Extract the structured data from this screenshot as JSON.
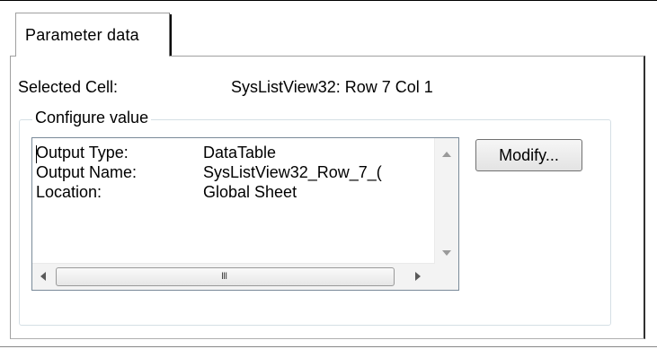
{
  "tab": {
    "label": "Parameter data"
  },
  "selected_cell": {
    "label": "Selected Cell:",
    "value": "SysListView32: Row 7 Col 1"
  },
  "configure_group": {
    "title": "Configure value",
    "rows": [
      {
        "key": "Output Type:",
        "value": "DataTable"
      },
      {
        "key": "Output Name:",
        "value": "SysListView32_Row_7_("
      },
      {
        "key": "Location:",
        "value": "Global Sheet"
      }
    ]
  },
  "buttons": {
    "modify": "Modify..."
  },
  "scrollbar": {
    "grip": "III"
  },
  "icons": {
    "scroll_up": "triangle-up",
    "scroll_down": "triangle-down",
    "scroll_left": "triangle-left",
    "scroll_right": "triangle-right"
  }
}
